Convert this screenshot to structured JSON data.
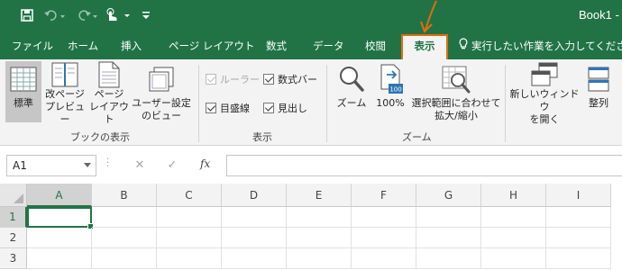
{
  "title_bar": {
    "book_title": "Book1 -",
    "qat_icons": [
      "save-icon",
      "undo-icon",
      "redo-icon",
      "touch-mode-icon",
      "customize-qat-icon"
    ]
  },
  "tabs": {
    "items": [
      "ファイル",
      "ホーム",
      "挿入",
      "ページ レイアウト",
      "数式",
      "データ",
      "校閲",
      "表示"
    ],
    "active": "表示",
    "tell_me": "実行したい作業を入力してくださ"
  },
  "ribbon": {
    "book_views": {
      "label": "ブックの表示",
      "normal": "標準",
      "page_break_1": "改ページ",
      "page_break_2": "プレビュー",
      "page_layout_1": "ページ",
      "page_layout_2": "レイアウト",
      "custom_views_1": "ユーザー設定",
      "custom_views_2": "のビュー"
    },
    "show": {
      "label": "表示",
      "ruler": "ルーラー",
      "formula_bar": "数式バー",
      "gridlines": "目盛線",
      "headings": "見出し"
    },
    "zoom": {
      "label": "ズーム",
      "zoom": "ズーム",
      "zoom_100": "100%",
      "zoom_sel_1": "選択範囲に合わせて",
      "zoom_sel_2": "拡大/縮小"
    },
    "window": {
      "new_window_1": "新しいウィンドウ",
      "new_window_2": "を開く",
      "arrange": "整列"
    }
  },
  "formula_bar": {
    "name_box": "A1",
    "fx": "fx",
    "cancel": "✕",
    "enter": "✓",
    "content": ""
  },
  "grid": {
    "columns": [
      "A",
      "B",
      "C",
      "D",
      "E",
      "F",
      "G",
      "H",
      "I"
    ],
    "rows": [
      "1",
      "2",
      "3"
    ],
    "active_cell": "A1"
  },
  "colors": {
    "excel_green": "#217346",
    "ribbon_bg": "#f3f3f3",
    "annotation_orange": "#e46c0a"
  }
}
